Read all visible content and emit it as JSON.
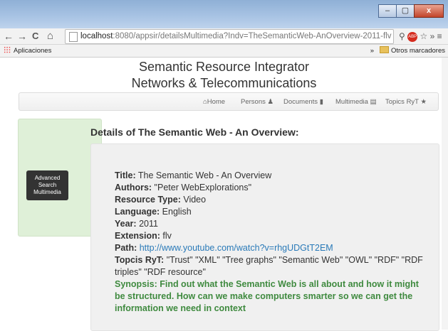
{
  "window": {
    "buttons": {
      "minimize": "–",
      "maximize": "▢",
      "close": "x"
    }
  },
  "browser": {
    "back_glyph": "←",
    "forward_glyph": "→",
    "reload_glyph": "C",
    "home_glyph": "⌂",
    "url_host": "localhost",
    "url_path": ":8080/appsir/detailsMultimedia?Indv=TheSemanticWeb-AnOverview-2011-flv",
    "ext_label": "ABP",
    "more_glyph": "»",
    "menu_glyph": "≡"
  },
  "bookmarks": {
    "apps_label": "Aplicaciones",
    "chevron": "»",
    "other_label": "Otros marcadores"
  },
  "site": {
    "title_line1": "Semantic Resource Integrator",
    "title_line2": "Networks & Telecommunications"
  },
  "nav": {
    "items": [
      {
        "label": "Home",
        "icon": "home-icon",
        "glyph": "⌂"
      },
      {
        "label": "Persons",
        "icon": "user-icon",
        "glyph": "♟"
      },
      {
        "label": "Documents",
        "icon": "file-icon",
        "glyph": "▮"
      },
      {
        "label": "Multimedia",
        "icon": "film-icon",
        "glyph": "▤"
      },
      {
        "label": "Topics RyT",
        "icon": "star-icon",
        "glyph": "★"
      }
    ]
  },
  "sidebar": {
    "button_line1": "Advanced",
    "button_line2": "Search",
    "button_line3": "Multimedia"
  },
  "details": {
    "heading": "Details of The Semantic Web - An Overview:",
    "title_label": "Title:",
    "title_value": " The Semantic Web - An Overview",
    "authors_label": "Authors:",
    "authors_value": " \"Peter WebExplorations\"",
    "type_label": "Resource Type:",
    "type_value": " Video",
    "language_label": "Language:",
    "language_value": " English",
    "year_label": "Year:",
    "year_value": " 2011",
    "extension_label": "Extension:",
    "extension_value": " flv",
    "path_label": "Path:",
    "path_value": "http://www.youtube.com/watch?v=rhgUDGtT2EM",
    "topics_label": "Topcis RyT:",
    "topics_value": " \"Trust\" \"XML\" \"Tree graphs\" \"Semantic Web\" \"OWL\" \"RDF\" \"RDF triples\" \"RDF resource\"",
    "synopsis": "Synopsis: Find out what the Semantic Web is all about and how it might be structured. How can we make computers smarter so we can get the information we need in context"
  }
}
